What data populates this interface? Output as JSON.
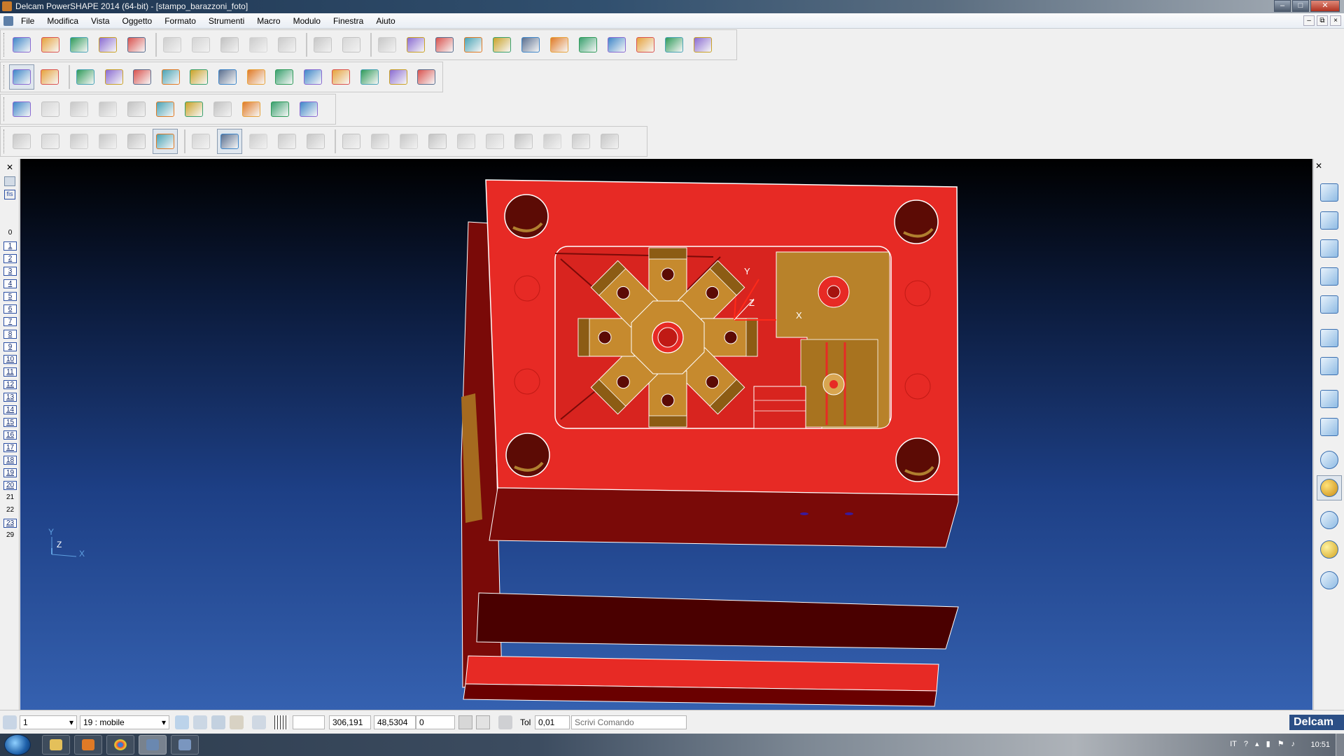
{
  "window": {
    "title": "Delcam PowerSHAPE 2014 (64-bit) - [stampo_barazzoni_foto]",
    "controls": [
      "minimize",
      "maximize",
      "close"
    ]
  },
  "menu": {
    "items": [
      "File",
      "Modifica",
      "Vista",
      "Oggetto",
      "Formato",
      "Strumenti",
      "Macro",
      "Modulo",
      "Finestra",
      "Aiuto"
    ],
    "mdi_controls": [
      "–",
      "⧉",
      "×"
    ]
  },
  "toolbars": {
    "main": [
      "new-file",
      "open-file",
      "import",
      "save",
      "print",
      "cut",
      "copy",
      "paste",
      "edit",
      "delete",
      "undo",
      "redo",
      "draw",
      "render",
      "workplane",
      "line",
      "circle",
      "curve",
      "text",
      "surface",
      "solid",
      "model",
      "tools",
      "wizard"
    ],
    "object": [
      "select",
      "transform",
      "arc",
      "x-y-axes",
      "move",
      "rotate",
      "box",
      "cube",
      "box-open",
      "block",
      "array",
      "pattern",
      "points",
      "sphere",
      "pyramid"
    ],
    "analysis": [
      "warning",
      "probe",
      "measure",
      "section",
      "tangent",
      "wand",
      "stack",
      "fill",
      "search",
      "cut-box",
      "repair"
    ],
    "surfaces": [
      "surface-grid",
      "cylinder",
      "star",
      "flower",
      "leaf",
      "patch",
      "wave",
      "band",
      "fold",
      "sweep",
      "loft",
      "curve-1",
      "curve-2",
      "curve-3",
      "curve-4",
      "curve-5",
      "curve-6",
      "curve-7",
      "curve-8",
      "curve-9",
      "curve-10"
    ]
  },
  "levels": [
    "0",
    "1",
    "2",
    "3",
    "4",
    "5",
    "6",
    "7",
    "8",
    "9",
    "10",
    "11",
    "12",
    "13",
    "14",
    "15",
    "16",
    "17",
    "18",
    "19",
    "20",
    "21",
    "22",
    "23",
    "29"
  ],
  "levels_active": [
    "1",
    "2",
    "3",
    "4",
    "5",
    "6",
    "7",
    "8",
    "9",
    "10",
    "11",
    "12",
    "13",
    "14",
    "15",
    "16",
    "17",
    "18",
    "19",
    "20",
    "23"
  ],
  "left_strip": {
    "fis_label": "fis"
  },
  "right_views": [
    "view-iso-1",
    "view-iso-2",
    "view-iso-3",
    "view-cube",
    "view-camera",
    "spin",
    "rotate",
    "zoom-box",
    "zoom-fit",
    "wireframe",
    "shaded",
    "diamond",
    "lighting",
    "lamp"
  ],
  "viewport": {
    "axis_labels": {
      "x": "X",
      "y": "Y",
      "z": "Z"
    },
    "triad": {
      "x": "X",
      "y": "Y",
      "z": "Z"
    },
    "colors": {
      "plate": "#e72a25",
      "plate_dark": "#6a0000",
      "cavity": "#b8822a",
      "bg_top": "#000000",
      "bg_bottom": "#3561b0"
    }
  },
  "status": {
    "level_value": "1",
    "workplane_value": "19 : mobile",
    "coord_x": "306,191",
    "coord_y": "48,5304",
    "coord_z": "0",
    "tol_label": "Tol",
    "tol_value": "0,01",
    "command_placeholder": "Scrivi Comando",
    "brand": "Delcam"
  },
  "taskbar": {
    "apps": [
      "explorer",
      "media",
      "chrome",
      "powershape",
      "app"
    ],
    "tray": {
      "lang": "IT"
    },
    "clock": "10:51"
  }
}
